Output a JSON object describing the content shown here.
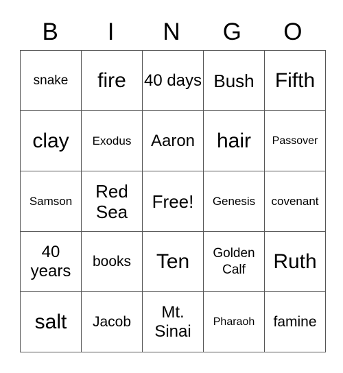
{
  "header": [
    "B",
    "I",
    "N",
    "G",
    "O"
  ],
  "grid": [
    [
      "snake",
      "fire",
      "40 days",
      "Bush",
      "Fifth"
    ],
    [
      "clay",
      "Exodus",
      "Aaron",
      "hair",
      "Passover"
    ],
    [
      "Samson",
      "Red Sea",
      "Free!",
      "Genesis",
      "covenant"
    ],
    [
      "40 years",
      "books",
      "Ten",
      "Golden Calf",
      "Ruth"
    ],
    [
      "salt",
      "Jacob",
      "Mt. Sinai",
      "Pharaoh",
      "famine"
    ]
  ]
}
